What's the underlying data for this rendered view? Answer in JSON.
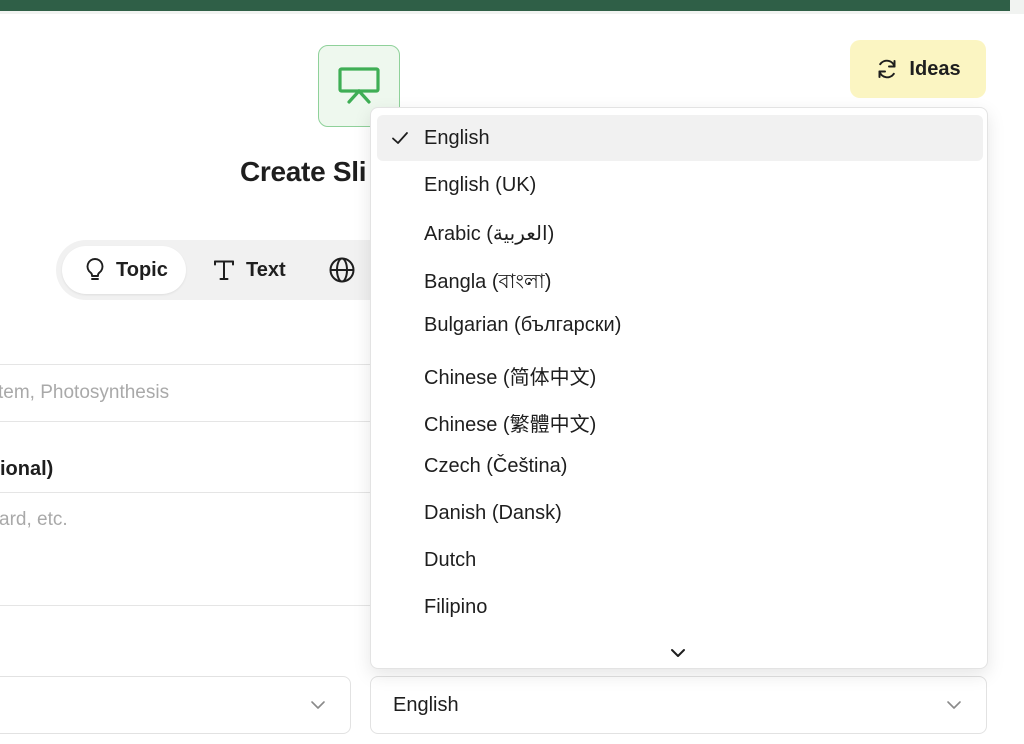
{
  "header": {
    "title": "Create Sli",
    "ideas_label": "Ideas"
  },
  "tabs": [
    {
      "label": "Topic",
      "icon": "lightbulb-icon",
      "active": true
    },
    {
      "label": "Text",
      "icon": "text-icon",
      "active": false
    },
    {
      "label": "",
      "icon": "globe-icon",
      "active": false
    }
  ],
  "form": {
    "topic_placeholder": "tem, Photosynthesis",
    "optional_label": "ional)",
    "notes_placeholder": "ard, etc.",
    "left_select_value": "",
    "language_select_value": "English"
  },
  "language_dropdown": {
    "selected": "English",
    "options": [
      "English",
      "English (UK)",
      "Arabic (العربية)",
      "Bangla (বাংলা)",
      "Bulgarian (български)",
      "Chinese (简体中文)",
      "Chinese (繁體中文)",
      "Czech (Čeština)",
      "Danish (Dansk)",
      "Dutch",
      "Filipino"
    ]
  },
  "colors": {
    "accent_bar": "#2f5f47",
    "logo_green": "#4caf50",
    "ideas_bg": "#fbf5c2"
  }
}
